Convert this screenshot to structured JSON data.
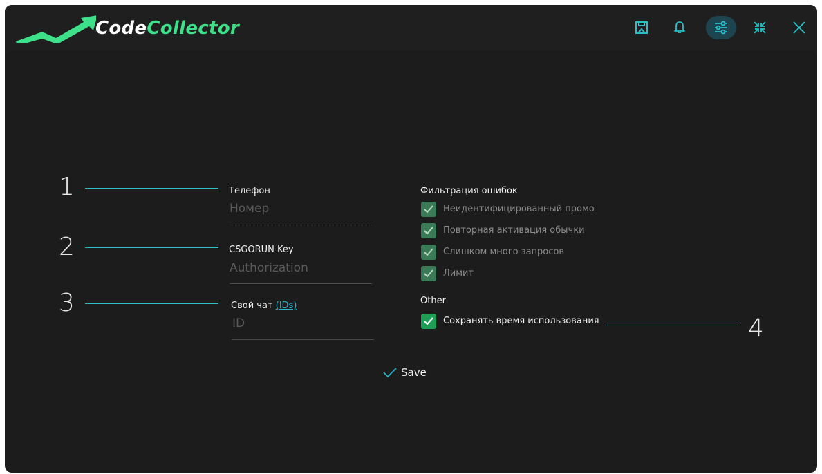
{
  "app": {
    "title_part1": "Code",
    "title_part2": "Collector",
    "accent_color": "#3fe08a",
    "link_color": "#27b3c9"
  },
  "titlebar": {
    "buttons": [
      {
        "icon": "save-icon"
      },
      {
        "icon": "bell-icon"
      },
      {
        "icon": "settings-sliders-icon",
        "active": true
      },
      {
        "icon": "minimize-icon"
      },
      {
        "icon": "close-icon"
      }
    ]
  },
  "callouts": [
    "1",
    "2",
    "3",
    "4"
  ],
  "form": {
    "phone": {
      "label": "Телефон",
      "placeholder": "Номер",
      "value": ""
    },
    "key": {
      "label": "CSGORUN Key",
      "placeholder": "Authorization",
      "value": ""
    },
    "chat": {
      "label": "Свой чат",
      "link": "(IDs)",
      "placeholder": "ID",
      "value": ""
    }
  },
  "filter": {
    "title": "Фильтрация ошибок",
    "options": [
      {
        "label": "Неидентифицированный промо",
        "checked": true,
        "enabled": false
      },
      {
        "label": "Повторная активация обычки",
        "checked": true,
        "enabled": false
      },
      {
        "label": "Слишком много запросов",
        "checked": true,
        "enabled": false
      },
      {
        "label": "Лимит",
        "checked": true,
        "enabled": false
      }
    ]
  },
  "other": {
    "title": "Other",
    "options": [
      {
        "label": "Сохранять время использования",
        "checked": true,
        "enabled": true
      }
    ]
  },
  "actions": {
    "save_label": "Save"
  }
}
